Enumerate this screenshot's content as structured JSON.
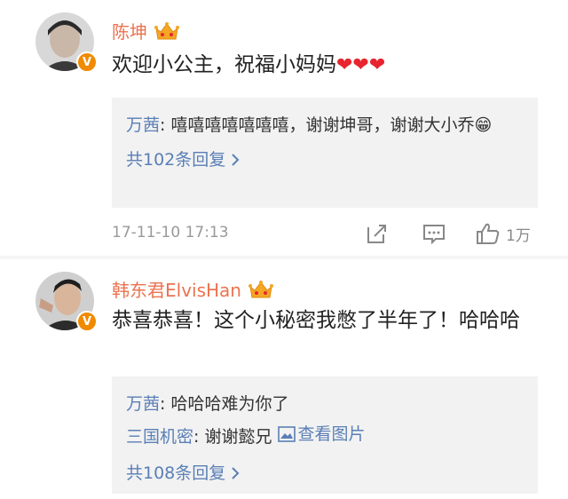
{
  "comments": [
    {
      "username": "陈坤",
      "text": "欢迎小公主，祝福小妈妈",
      "replies": [
        {
          "name": "万茜",
          "separator": ": ",
          "text": "嘻嘻嘻嘻嘻嘻嘻，谢谢坤哥，谢谢大小乔😁"
        }
      ],
      "more_replies": "共102条回复",
      "timestamp": "17-11-10 17:13",
      "like_count": "1万"
    },
    {
      "username": "韩东君ElvisHan",
      "text": "恭喜恭喜！这个小秘密我憋了半年了！哈哈哈",
      "replies": [
        {
          "name": "万茜",
          "separator": ": ",
          "text": "哈哈哈难为你了"
        },
        {
          "name": "三国机密",
          "separator": ": ",
          "text": "谢谢懿兄 ",
          "image_link": "查看图片"
        }
      ],
      "more_replies": "共108条回复"
    }
  ],
  "icons": {
    "crown": "crown-icon",
    "verified": "V",
    "heart": "❤",
    "share": "share-icon",
    "comment": "comment-icon",
    "like": "thumbs-up-icon",
    "chevron": "chevron-right-icon",
    "image": "image-icon"
  },
  "colors": {
    "username": "#eb7350",
    "link": "#5a7fb5",
    "heart": "#e8242e",
    "badge": "#f08a00"
  }
}
